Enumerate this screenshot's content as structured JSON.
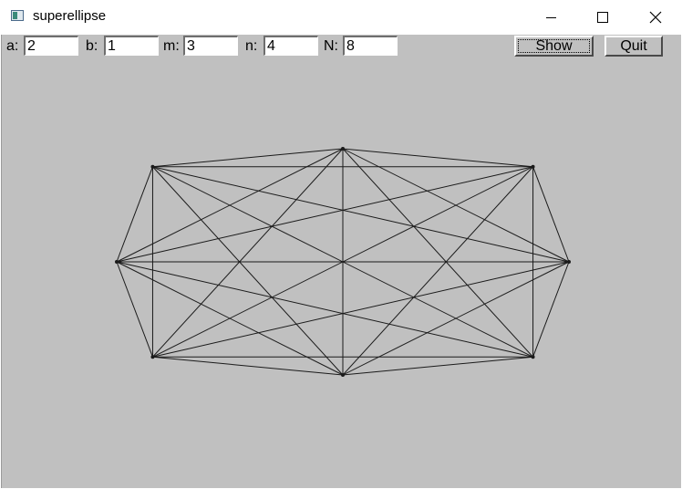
{
  "window": {
    "title": "superellipse",
    "icon": "app-window-icon",
    "controls": [
      "minimize-icon",
      "maximize-icon",
      "close-icon"
    ]
  },
  "toolbar": {
    "a_label": "a:",
    "a_value": "2",
    "b_label": "b:",
    "b_value": "1",
    "m_label": "m:",
    "m_value": "3",
    "n_label": "n:",
    "n_value": "4",
    "N_label": "N:",
    "N_value": "8",
    "show_label": "Show",
    "quit_label": "Quit"
  },
  "canvas": {
    "background": "#c0c0c0",
    "line_color": "#1a1a1a",
    "a": 2,
    "b": 1,
    "m": 3,
    "n": 4,
    "N": 8
  }
}
